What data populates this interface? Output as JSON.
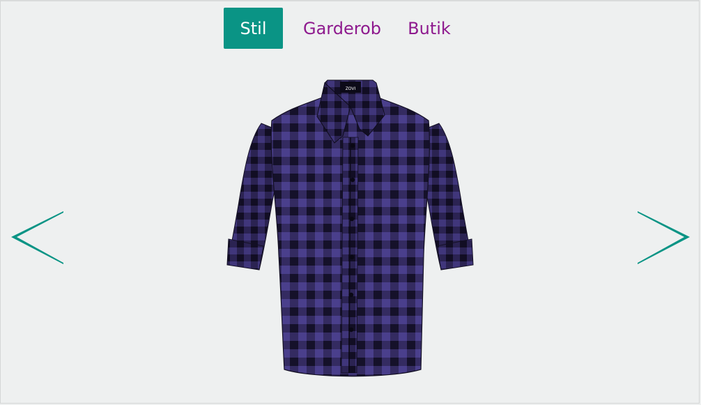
{
  "tabs": [
    {
      "label": "Stil",
      "active": true
    },
    {
      "label": "Garderob",
      "active": false
    },
    {
      "label": "Butik",
      "active": false
    }
  ],
  "colors": {
    "accent": "#0a9485",
    "tab_text": "#8e1a8e",
    "background": "#eef0f0",
    "shirt_light": "#4a3f8c",
    "shirt_dark": "#1d1735"
  },
  "icons": {
    "prev": "chevron-left-icon",
    "next": "chevron-right-icon"
  }
}
